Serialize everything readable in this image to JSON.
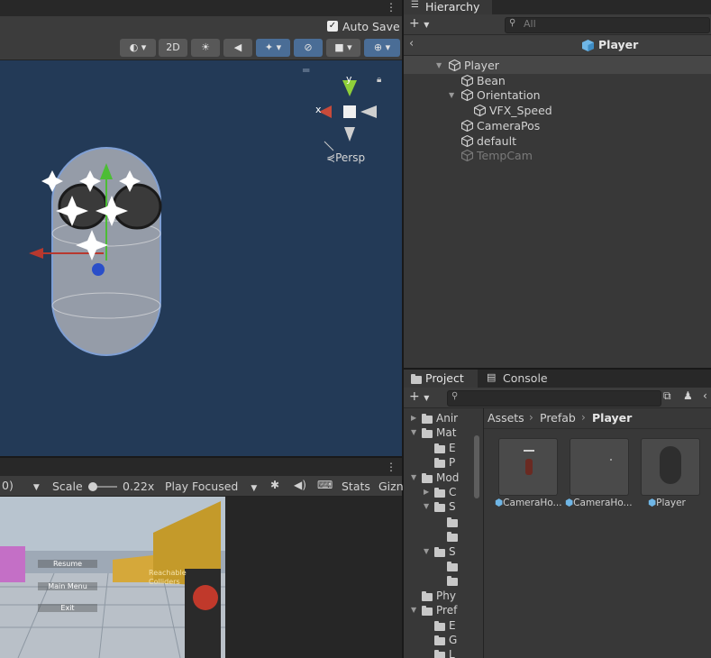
{
  "scene": {
    "auto_save_label": "Auto Save",
    "btn_2d": "2D",
    "view_label": "Persp",
    "axis_x": "x",
    "axis_y": "y"
  },
  "game": {
    "left_value": "0)",
    "scale_label": "Scale",
    "scale_value": "0.22x",
    "play_mode": "Play Focused",
    "stats_label": "Stats",
    "gizmos_label": "Gizn",
    "menu": {
      "resume": "Resume",
      "main_menu": "Main Menu",
      "exit": "Exit"
    },
    "wall_text": "Reachable Colliders"
  },
  "hierarchy": {
    "tab_label": "Hierarchy",
    "search_placeholder": "All",
    "header_title": "Player",
    "items": [
      {
        "label": "Player",
        "depth": 0,
        "expanded": true
      },
      {
        "label": "Bean",
        "depth": 1
      },
      {
        "label": "Orientation",
        "depth": 1,
        "expanded": true
      },
      {
        "label": "VFX_Speed",
        "depth": 2
      },
      {
        "label": "CameraPos",
        "depth": 1
      },
      {
        "label": "default",
        "depth": 1
      },
      {
        "label": "TempCam",
        "depth": 1,
        "disabled": true
      }
    ]
  },
  "project": {
    "tab_project": "Project",
    "tab_console": "Console",
    "breadcrumb": [
      "Assets",
      "Prefab",
      "Player"
    ],
    "tree": [
      {
        "label": "Anir",
        "depth": 1,
        "arrow": "right"
      },
      {
        "label": "Mat",
        "depth": 1,
        "arrow": "down"
      },
      {
        "label": "E",
        "depth": 2
      },
      {
        "label": "P",
        "depth": 2
      },
      {
        "label": "Mod",
        "depth": 1,
        "arrow": "down"
      },
      {
        "label": "C",
        "depth": 2,
        "arrow": "right"
      },
      {
        "label": "S",
        "depth": 2,
        "arrow": "down"
      },
      {
        "label": "",
        "depth": 3
      },
      {
        "label": "",
        "depth": 3
      },
      {
        "label": "S",
        "depth": 2,
        "arrow": "down"
      },
      {
        "label": "",
        "depth": 3
      },
      {
        "label": "",
        "depth": 3
      },
      {
        "label": "Phy",
        "depth": 1
      },
      {
        "label": "Pref",
        "depth": 1,
        "arrow": "down"
      },
      {
        "label": "E",
        "depth": 2
      },
      {
        "label": "G",
        "depth": 2
      },
      {
        "label": "L",
        "depth": 2
      }
    ],
    "assets": [
      {
        "label": "CameraHo..."
      },
      {
        "label": "CameraHo..."
      },
      {
        "label": "Player"
      }
    ]
  },
  "colors": {
    "scene_bg": "#233a57",
    "panel_bg": "#383838",
    "accent_blue": "#4a6d96"
  }
}
